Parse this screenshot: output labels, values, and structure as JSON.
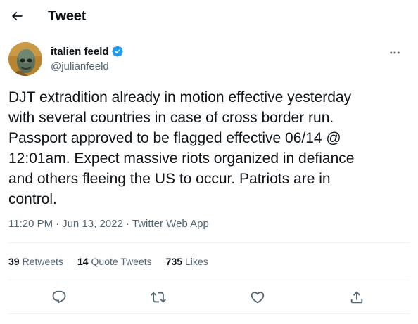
{
  "header": {
    "title": "Tweet",
    "back_icon": "arrow-left-icon"
  },
  "author": {
    "display_name": "italien feeld",
    "handle": "@julianfeeld",
    "verified": true,
    "verified_color": "#1d9bf0",
    "more_icon": "more-horizontal-icon"
  },
  "tweet": {
    "text": "DJT extradition already in motion effective yesterday\nwith several countries in case of cross border run.\nPassport approved to be flagged effective 06/14 @\n12:01am. Expect massive riots organized in defiance\nand others fleeing the US to occur. Patriots are in\ncontrol.",
    "time": "11:20 PM",
    "date": "Jun 13, 2022",
    "separator": "·",
    "source": "Twitter Web App"
  },
  "stats": [
    {
      "count": "39",
      "label": "Retweets"
    },
    {
      "count": "14",
      "label": "Quote Tweets"
    },
    {
      "count": "735",
      "label": "Likes"
    }
  ],
  "actions": [
    {
      "icon": "reply-icon"
    },
    {
      "icon": "retweet-icon"
    },
    {
      "icon": "like-icon"
    },
    {
      "icon": "share-icon"
    }
  ],
  "colors": {
    "text": "#0f1419",
    "secondary": "#536471",
    "divider": "#eff3f4",
    "accent": "#1d9bf0"
  }
}
